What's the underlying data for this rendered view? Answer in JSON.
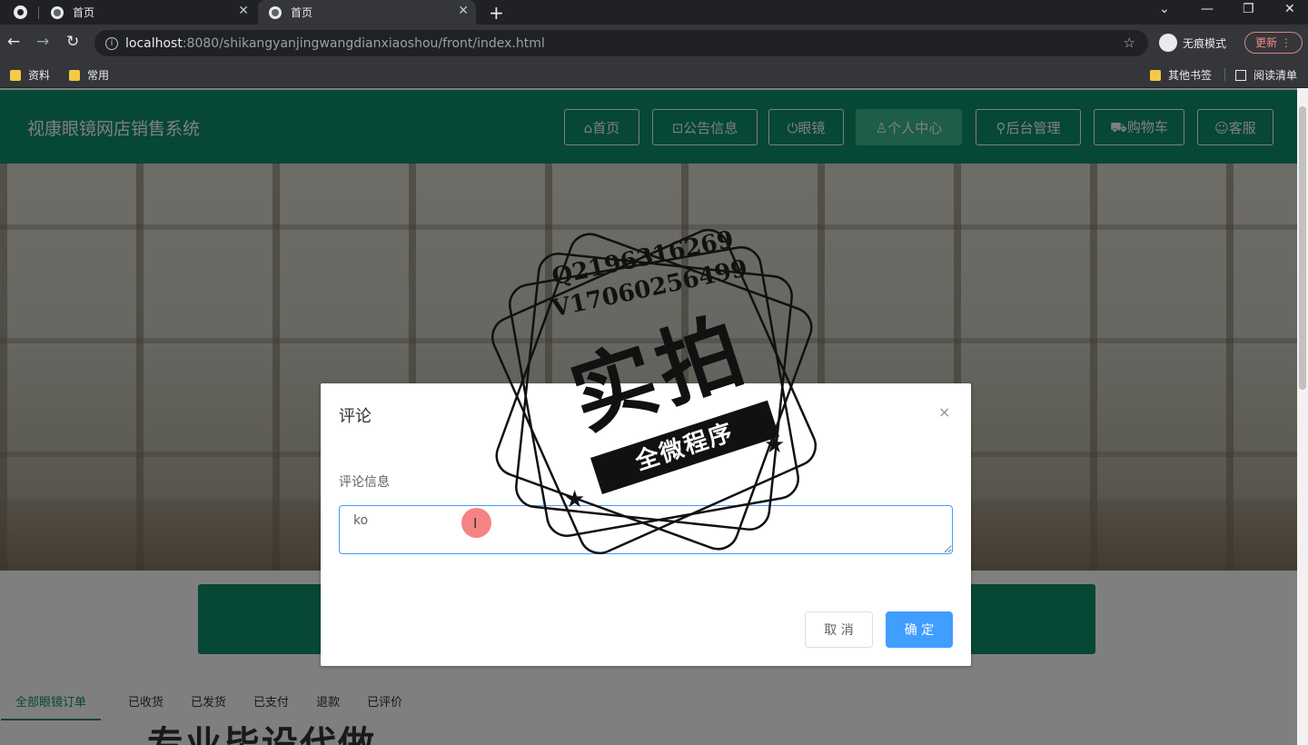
{
  "browser": {
    "tabs": [
      {
        "title": "首页"
      },
      {
        "title": "首页"
      }
    ],
    "new_tab": "+",
    "window_controls": [
      "⌄",
      "—",
      "❐",
      "✕"
    ],
    "url_host": "localhost",
    "url_rest": ":8080/shikangyanjingwangdianxiaoshou/front/index.html",
    "incognito_label": "无痕模式",
    "update_label": "更新",
    "bookmarks": {
      "left": [
        "资料",
        "常用"
      ],
      "other": "其他书签",
      "reading_list": "阅读清单"
    }
  },
  "site": {
    "title": "视康眼镜网店销售系统",
    "nav": [
      "⌂首页",
      "⊡公告信息",
      "⏻眼镜",
      "♙个人中心",
      "⚲后台管理",
      "⛟购物车",
      "☺客服"
    ],
    "active_nav_index": 3
  },
  "order_tabs": [
    "全部眼镜订单",
    "已收货",
    "已发货",
    "已支付",
    "退款",
    "已评价"
  ],
  "background_text": "专业毕设代做",
  "dialog": {
    "title": "评论",
    "close": "×",
    "field_label": "评论信息",
    "field_value": "ko",
    "cancel_label": "取 消",
    "confirm_label": "确 定"
  },
  "watermark": {
    "line1": "Q2196316269",
    "line2": "V17060256499",
    "main": "实拍",
    "band": "全微程序"
  },
  "colors": {
    "header_green": "#0d8f6b",
    "active_nav": "#3dbb90",
    "primary_button": "#409eff"
  }
}
